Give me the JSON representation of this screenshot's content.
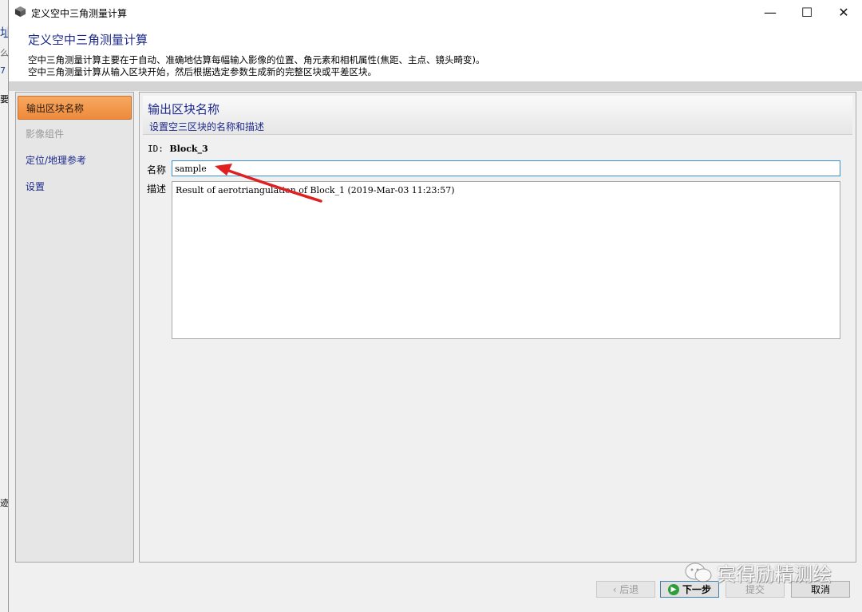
{
  "window": {
    "title": "定义空中三角测量计算",
    "minimize_glyph": "—",
    "maximize_glyph": "☐",
    "close_glyph": "✕"
  },
  "header": {
    "title": "定义空中三角测量计算",
    "desc_line1": "空中三角测量计算主要在于自动、准确地估算每幅输入影像的位置、角元素和相机属性(焦距、主点、镜头畸变)。",
    "desc_line2": "空中三角测量计算从输入区块开始，然后根据选定参数生成新的完整区块或平差区块。"
  },
  "sidebar": {
    "items": [
      {
        "label": "输出区块名称"
      },
      {
        "label": "影像组件"
      },
      {
        "label": "定位/地理参考"
      },
      {
        "label": "设置"
      }
    ]
  },
  "main": {
    "title": "输出区块名称",
    "subtitle": "设置空三区块的名称和描述",
    "id_label": "ID:",
    "id_value": "Block_3",
    "name_label": "名称",
    "name_value": "sample",
    "desc_label": "描述",
    "desc_value": "Result of aerotriangulation of Block_1 (2019-Mar-03 11:23:57)"
  },
  "footer": {
    "back_label": "‹ 后退",
    "next_label": "下一步",
    "submit_label": "提交",
    "cancel_label": "取消"
  },
  "watermark": {
    "text": "宾得励精测绘"
  },
  "backdrop": {
    "glyphs": [
      "址",
      "么",
      "7",
      "要",
      "迹"
    ]
  },
  "colors": {
    "accent_text": "#1d2a8c",
    "active_item": "#ee8a3c",
    "arrow": "#e02020"
  }
}
